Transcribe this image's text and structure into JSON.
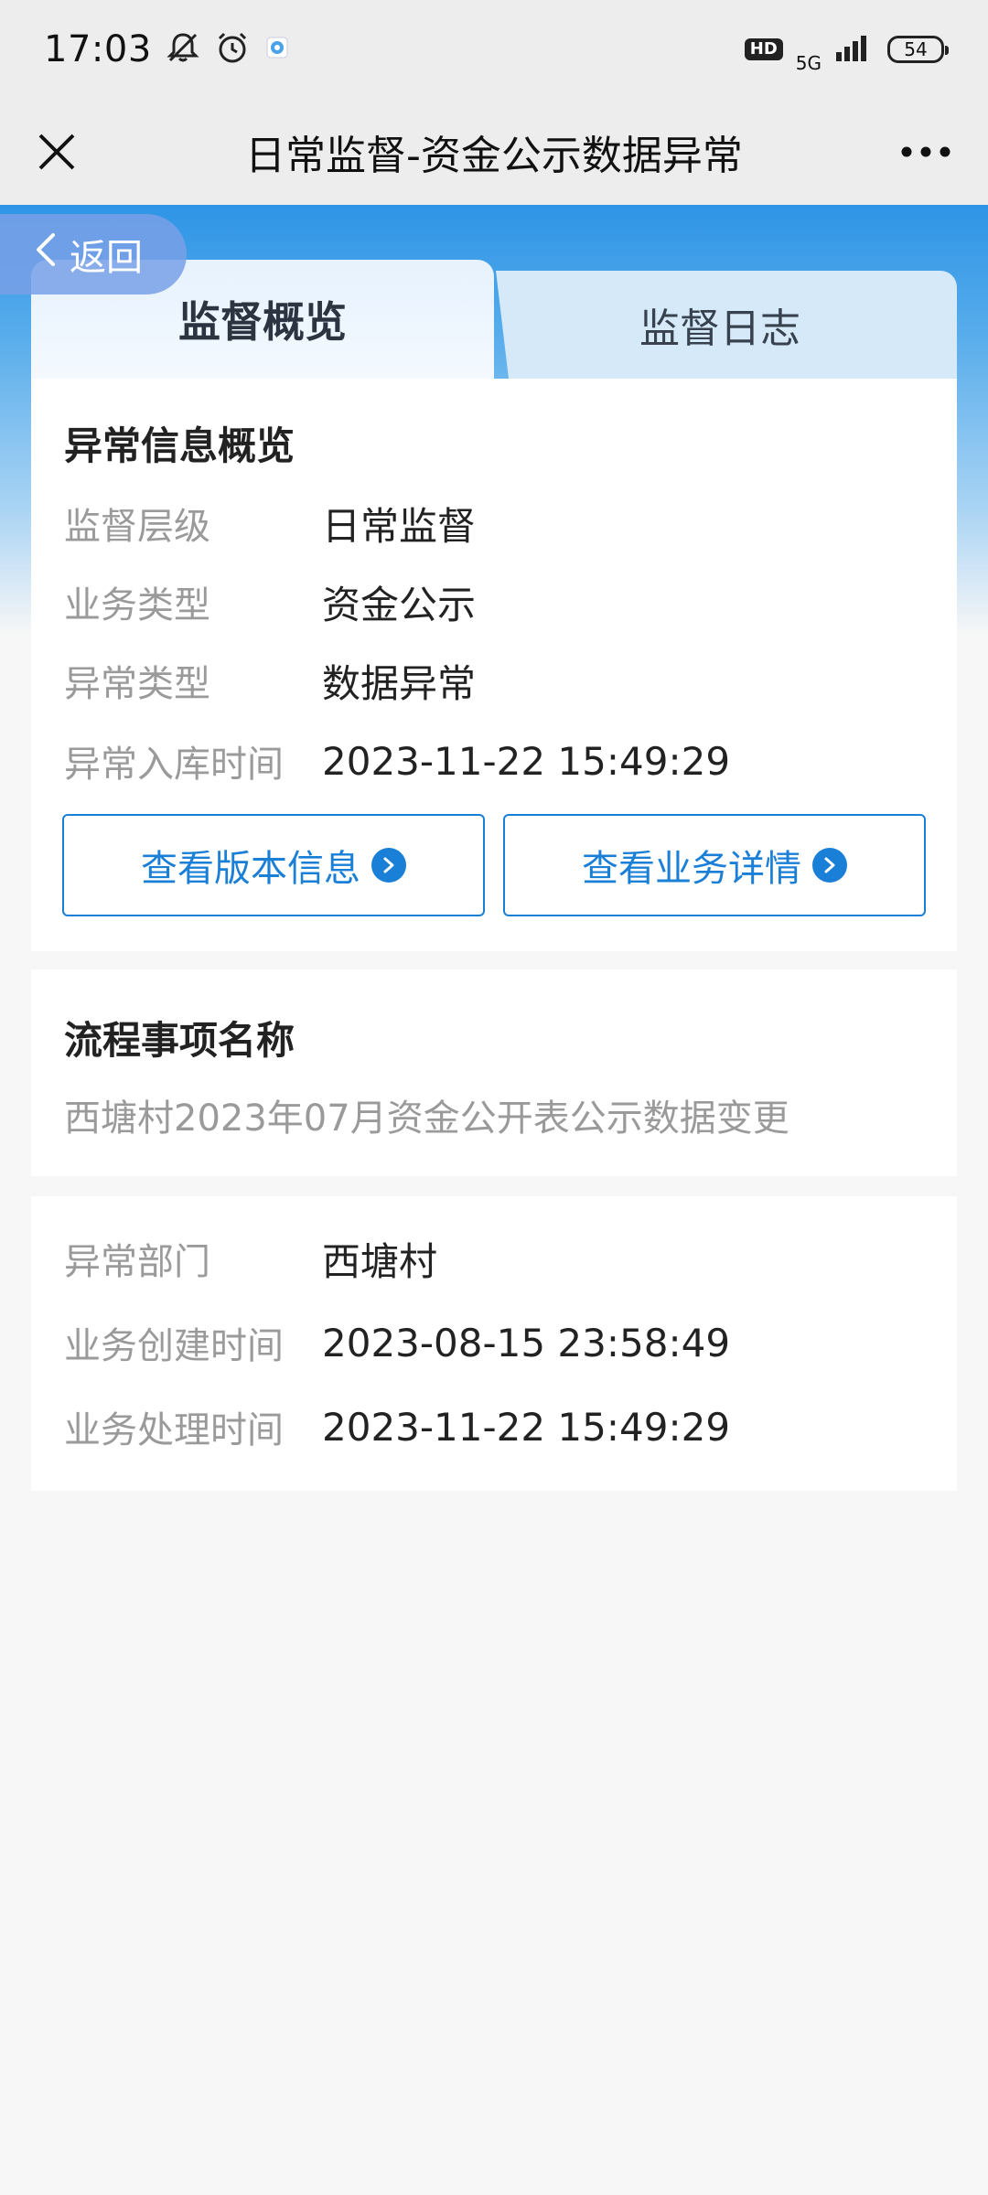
{
  "status_bar": {
    "time": "17:03",
    "icons": [
      "bell-off-icon",
      "alarm-icon",
      "app-notification-icon"
    ],
    "hd": "HD",
    "network": "5G",
    "battery": "54"
  },
  "title_bar": {
    "title": "日常监督-资金公示数据异常",
    "close_icon": "close-icon",
    "more_icon": "more-dots-icon"
  },
  "back": {
    "label": "返回"
  },
  "tabs": [
    {
      "label": "监督概览",
      "active": true
    },
    {
      "label": "监督日志",
      "active": false
    }
  ],
  "overview": {
    "title": "异常信息概览",
    "rows": [
      {
        "label": "监督层级",
        "value": "日常监督"
      },
      {
        "label": "业务类型",
        "value": "资金公示"
      },
      {
        "label": "异常类型",
        "value": "数据异常"
      },
      {
        "label": "异常入库时间",
        "value": "2023-11-22 15:49:29"
      }
    ],
    "buttons": {
      "version": "查看版本信息",
      "detail": "查看业务详情"
    }
  },
  "process": {
    "title": "流程事项名称",
    "value": "西塘村2023年07月资金公开表公示数据变更"
  },
  "department": {
    "rows": [
      {
        "label": "异常部门",
        "value": "西塘村"
      },
      {
        "label": "业务创建时间",
        "value": "2023-08-15 23:58:49"
      },
      {
        "label": "业务处理时间",
        "value": "2023-11-22 15:49:29"
      }
    ]
  },
  "colors": {
    "accent": "#1a7fd6",
    "header_blue": "#2e94e6",
    "label_gray": "#9a9a9a"
  }
}
